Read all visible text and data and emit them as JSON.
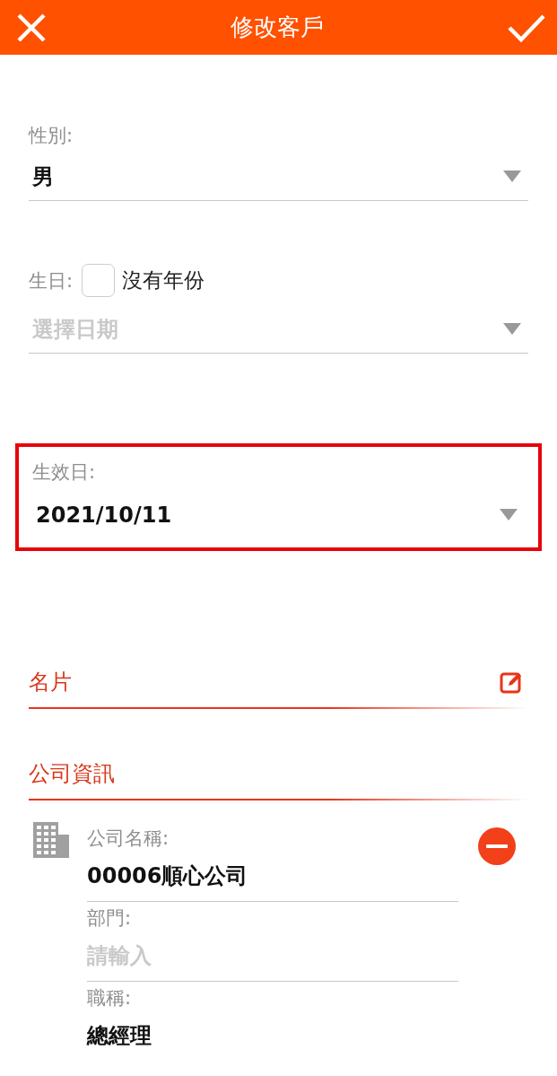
{
  "header": {
    "title": "修改客戶"
  },
  "gender": {
    "label": "性別:",
    "value": "男"
  },
  "birthday": {
    "label": "生日:",
    "no_year": {
      "label": "沒有年份",
      "checked": false
    },
    "placeholder": "選擇日期"
  },
  "effective_date": {
    "label": "生效日:",
    "value": "2021/10/11",
    "highlighted": true
  },
  "sections": [
    {
      "title": "名片",
      "editable": true
    },
    {
      "title": "公司資訊",
      "editable": false
    }
  ],
  "company": {
    "fields": [
      {
        "label": "公司名稱:",
        "value": "00006順心公司"
      },
      {
        "label": "部門:",
        "placeholder": "請輸入"
      },
      {
        "label": "職稱:",
        "value": "總經理"
      }
    ]
  }
}
